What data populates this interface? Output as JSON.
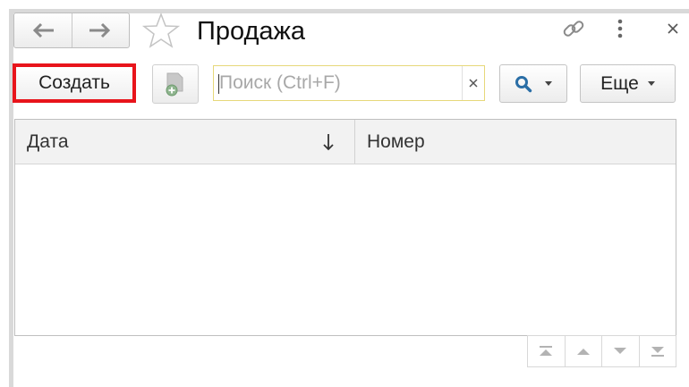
{
  "window": {
    "title": "Продажа"
  },
  "toolbar": {
    "create_label": "Создать",
    "more_label": "Еще"
  },
  "search": {
    "placeholder": "Поиск (Ctrl+F)",
    "value": ""
  },
  "table": {
    "columns": [
      {
        "label": "Дата",
        "sort": "descending"
      },
      {
        "label": "Номер"
      }
    ],
    "rows": []
  },
  "colors": {
    "highlight": "#e8141b",
    "search_border": "#e6d87a",
    "search_icon": "#2a6ea6",
    "header_bg": "#f2f2f2"
  },
  "icons": {
    "back": "arrow-left-icon",
    "forward": "arrow-right-icon",
    "favorite": "star-icon",
    "link": "link-icon",
    "menu": "more-vertical-icon",
    "close": "close-icon",
    "add_copy": "add-copy-icon",
    "clear": "clear-icon",
    "search": "search-icon",
    "sort": "sort-down-icon",
    "pager": [
      "first-page-icon",
      "prev-page-icon",
      "next-page-icon",
      "last-page-icon"
    ]
  }
}
